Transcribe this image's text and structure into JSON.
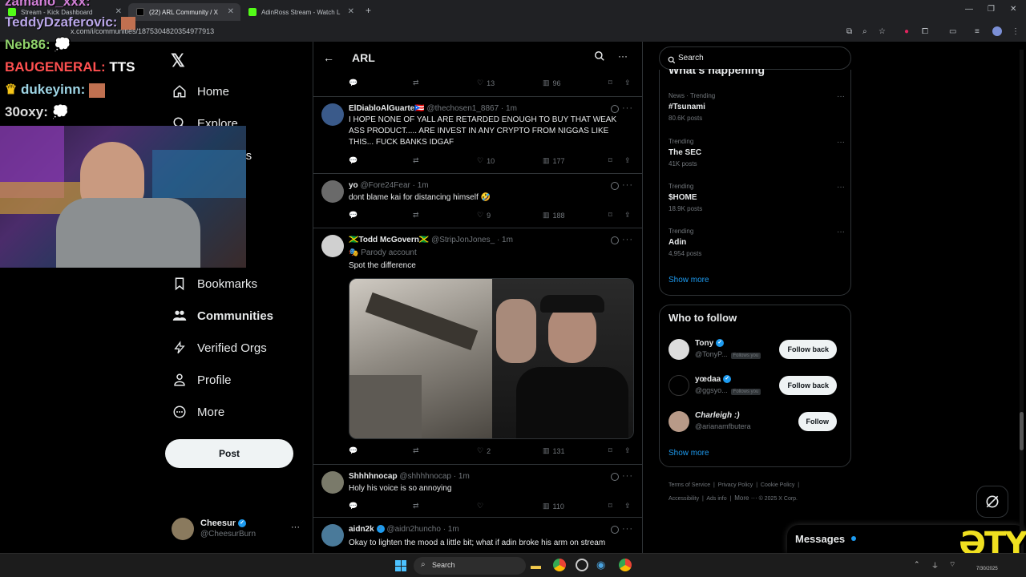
{
  "browser": {
    "tabs": [
      {
        "label": "Stream - Kick Dashboard"
      },
      {
        "label": "(22) ARL Community / X"
      },
      {
        "label": "AdinRoss Stream - Watch L"
      }
    ],
    "url": "x.com/i/communities/1875304820354977913"
  },
  "chat_overlay": [
    {
      "user": "zamano_xxx:",
      "color": "#d17fd6"
    },
    {
      "user": "TeddyDzaferovic:",
      "color": "#b9a6e8"
    },
    {
      "user": "Neb86:",
      "color": "#8fd16a"
    },
    {
      "user": "BAUGENERAL:",
      "color": "#ff5050",
      "msg": "TTS"
    },
    {
      "user": "dukeyinn:",
      "color": "#9fd6e6"
    },
    {
      "user": "30oxy:",
      "color": "#e0e0e0"
    }
  ],
  "nav": {
    "home": "Home",
    "explore": "Explore",
    "notifications_partial": "ons",
    "bookmarks": "Bookmarks",
    "communities": "Communities",
    "verified_orgs": "Verified Orgs",
    "profile": "Profile",
    "more": "More",
    "post": "Post"
  },
  "account": {
    "name": "Cheesur",
    "handle": "@CheesurBurn"
  },
  "header": {
    "title": "ARL"
  },
  "tweets": [
    {
      "id": "t0",
      "replies": "",
      "likes": "13",
      "views": "96"
    },
    {
      "id": "t1",
      "name": "ElDiabloAlGuarte🇵🇷",
      "handle": "@thechosen1_8867",
      "time": "· 1m",
      "text": "I HOPE NONE OF YALL ARE RETARDED ENOUGH TO BUY THAT WEAK ASS PRODUCT..... ARE INVEST IN ANY CRYPTO FROM NIGGAS LIKE THIS... FUCK BANKS IDGAF",
      "likes": "10",
      "views": "177"
    },
    {
      "id": "t2",
      "name": "yo",
      "handle": "@Fore24Fear",
      "time": "· 1m",
      "text": "dont blame kai for distancing himself 🤣",
      "likes": "9",
      "views": "188"
    },
    {
      "id": "t3",
      "name": "🇯🇲Todd McGovern🇯🇲",
      "handle": "@StripJonJones_",
      "time": "· 1m",
      "label": "Parody account",
      "text": "Spot the difference",
      "likes": "2",
      "views": "131"
    },
    {
      "id": "t4",
      "name": "Shhhhnocap",
      "handle": "@shhhhnocap",
      "time": "· 1m",
      "text": "Holy his voice is so annoying",
      "likes": "",
      "views": "110"
    },
    {
      "id": "t5",
      "name": "aidn2k",
      "handle": "@aidn2huncho",
      "time": "· 1m",
      "text": "Okay to lighten the mood a little bit; what if adin broke his arm on stream"
    }
  ],
  "search": {
    "placeholder": "Search"
  },
  "whats_happening": {
    "title": "What's happening",
    "trends": [
      {
        "category": "News · Trending",
        "name": "#Tsunami",
        "count": "80.6K posts"
      },
      {
        "category": "Trending",
        "name": "The SEC",
        "count": "41K posts"
      },
      {
        "category": "Trending",
        "name": "$HOME",
        "count": "18.9K posts"
      },
      {
        "category": "Trending",
        "name": "Adin",
        "count": "4,954 posts"
      }
    ],
    "show_more": "Show more"
  },
  "who_to_follow": {
    "title": "Who to follow",
    "users": [
      {
        "name": "Tony",
        "handle": "@TonyP...",
        "follows_you": "Follows you",
        "button": "Follow back",
        "verified": true
      },
      {
        "name": "yœdaa",
        "handle": "@ggsyo...",
        "follows_you": "Follows you",
        "button": "Follow back",
        "verified": true
      },
      {
        "name": "Charleigh :)",
        "handle": "@arianamfbutera",
        "follows_you": "",
        "button": "Follow",
        "verified": false
      }
    ],
    "show_more": "Show more"
  },
  "footer": {
    "links": [
      "Terms of Service",
      "Privacy Policy",
      "Cookie Policy",
      "Accessibility",
      "Ads info",
      "More ···"
    ],
    "copyright": "© 2025 X Corp."
  },
  "messages": {
    "label": "Messages"
  },
  "taskbar": {
    "search": "Search",
    "date": "7/30/2025"
  },
  "watermark": "ƏTY"
}
